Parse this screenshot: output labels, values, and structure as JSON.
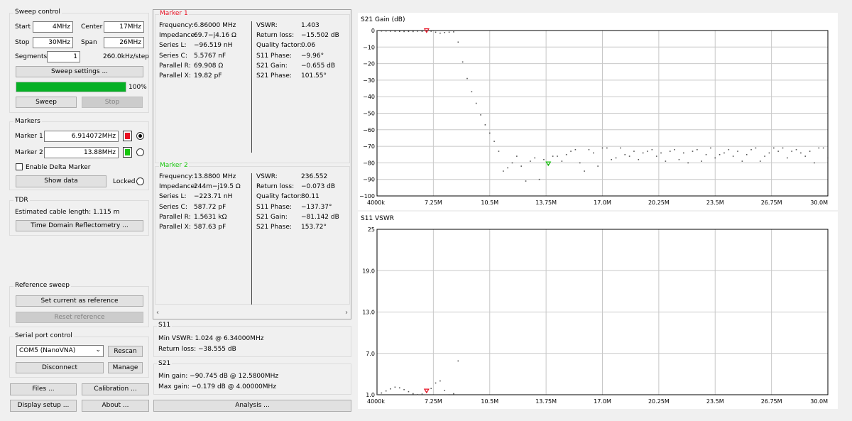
{
  "sweep_control": {
    "title": "Sweep control",
    "start_label": "Start",
    "start_value": "4MHz",
    "center_label": "Center",
    "center_value": "17MHz",
    "stop_label": "Stop",
    "stop_value": "30MHz",
    "span_label": "Span",
    "span_value": "26MHz",
    "segments_label": "Segments",
    "segments_value": "1",
    "step_text": "260.0kHz/step",
    "settings_button": "Sweep settings ...",
    "progress": 100,
    "progress_text": "100%",
    "sweep_button": "Sweep",
    "stop_button": "Stop"
  },
  "markers": {
    "title": "Markers",
    "marker1_label": "Marker 1",
    "marker1_value": "6.914072MHz",
    "marker1_color": "#e81123",
    "marker2_label": "Marker 2",
    "marker2_value": "13.88MHz",
    "marker2_color": "#16c60c",
    "delta_label": "Enable Delta Marker",
    "show_data_button": "Show data",
    "locked_label": "Locked"
  },
  "tdr": {
    "title": "TDR",
    "cable_text": "Estimated cable length:  1.115 m",
    "button": "Time Domain Reflectometry ..."
  },
  "reference": {
    "title": "Reference sweep",
    "set_button": "Set current as reference",
    "reset_button": "Reset reference"
  },
  "serial": {
    "title": "Serial port control",
    "port_value": "COM5 (NanoVNA)",
    "rescan_button": "Rescan",
    "disconnect_button": "Disconnect",
    "manage_button": "Manage"
  },
  "bottom_buttons": {
    "files": "Files ...",
    "calibration": "Calibration ...",
    "display_setup": "Display setup ...",
    "about": "About ...",
    "analysis": "Analysis ..."
  },
  "marker1_data": {
    "title": "Marker 1",
    "left": [
      {
        "k": "Frequency:",
        "v": "6.86000 MHz"
      },
      {
        "k": "Impedance:",
        "v": "69.7−j4.16 Ω"
      },
      {
        "k": "Series L:",
        "v": "−96.519 nH"
      },
      {
        "k": "Series C:",
        "v": "5.5767 nF"
      },
      {
        "k": "Parallel R:",
        "v": "69.908 Ω"
      },
      {
        "k": "Parallel X:",
        "v": "19.82 pF"
      }
    ],
    "right": [
      {
        "k": "VSWR:",
        "v": "1.403"
      },
      {
        "k": "Return loss:",
        "v": "−15.502 dB"
      },
      {
        "k": "Quality factor:",
        "v": "0.06"
      },
      {
        "k": "S11 Phase:",
        "v": "−9.96°"
      },
      {
        "k": "S21 Gain:",
        "v": "−0.655 dB"
      },
      {
        "k": "S21 Phase:",
        "v": "101.55°"
      }
    ]
  },
  "marker2_data": {
    "title": "Marker 2",
    "left": [
      {
        "k": "Frequency:",
        "v": "13.8800 MHz"
      },
      {
        "k": "Impedance:",
        "v": "244m−j19.5 Ω"
      },
      {
        "k": "Series L:",
        "v": "−223.71 nH"
      },
      {
        "k": "Series C:",
        "v": "587.72 pF"
      },
      {
        "k": "Parallel R:",
        "v": "1.5631 kΩ"
      },
      {
        "k": "Parallel X:",
        "v": "587.63 pF"
      }
    ],
    "right": [
      {
        "k": "VSWR:",
        "v": "236.552"
      },
      {
        "k": "Return loss:",
        "v": "−0.073 dB"
      },
      {
        "k": "Quality factor:",
        "v": "80.11"
      },
      {
        "k": "S11 Phase:",
        "v": "−137.37°"
      },
      {
        "k": "S21 Gain:",
        "v": "−81.142 dB"
      },
      {
        "k": "S21 Phase:",
        "v": "153.72°"
      }
    ]
  },
  "s11_summary": {
    "title": "S11",
    "min_vswr": "Min VSWR:  1.024 @ 6.34000MHz",
    "return_loss": "Return loss:  −38.555 dB"
  },
  "s21_summary": {
    "title": "S21",
    "min_gain": "Min gain:  −90.745 dB @ 12.5800MHz",
    "max_gain": "Max gain:  −0.179 dB @ 4.00000MHz"
  },
  "chart_data": [
    {
      "type": "scatter",
      "title": "S21 Gain (dB)",
      "x_unit": "MHz",
      "xlim": [
        4.0,
        30.0
      ],
      "ylim": [
        -100,
        0
      ],
      "x_ticks": [
        4.0,
        7.25,
        10.5,
        13.75,
        17.0,
        20.25,
        23.5,
        26.75,
        30.0
      ],
      "x_tick_labels": [
        "4000k",
        "7.25M",
        "10.5M",
        "13.75M",
        "17.0M",
        "20.25M",
        "23.5M",
        "26.75M",
        "30.0M"
      ],
      "y_ticks": [
        0,
        -10,
        -20,
        -30,
        -40,
        -50,
        -60,
        -70,
        -80,
        -90,
        -100
      ],
      "y_tick_labels": [
        "0",
        "−10",
        "−20",
        "−30",
        "−40",
        "−50",
        "−60",
        "−70",
        "−80",
        "−90",
        "−100"
      ],
      "grid": true,
      "series": [
        {
          "color": "#555555",
          "points": [
            [
              4.0,
              -0.2
            ],
            [
              4.26,
              -0.3
            ],
            [
              4.52,
              -0.3
            ],
            [
              4.78,
              -0.4
            ],
            [
              5.04,
              -0.5
            ],
            [
              5.3,
              -0.5
            ],
            [
              5.56,
              -0.6
            ],
            [
              5.82,
              -0.5
            ],
            [
              6.08,
              -0.6
            ],
            [
              6.34,
              -0.4
            ],
            [
              6.6,
              -0.5
            ],
            [
              6.86,
              -0.6
            ],
            [
              7.12,
              -0.4
            ],
            [
              7.38,
              -1.0
            ],
            [
              7.64,
              -1.6
            ],
            [
              7.9,
              -1.2
            ],
            [
              8.16,
              -1.0
            ],
            [
              8.42,
              -0.8
            ],
            [
              8.68,
              -7
            ],
            [
              8.94,
              -19
            ],
            [
              9.2,
              -29
            ],
            [
              9.46,
              -37
            ],
            [
              9.72,
              -44
            ],
            [
              9.98,
              -51
            ],
            [
              10.24,
              -57
            ],
            [
              10.5,
              -62
            ],
            [
              10.76,
              -67
            ],
            [
              11.02,
              -73
            ],
            [
              11.28,
              -85
            ],
            [
              11.54,
              -83
            ],
            [
              11.8,
              -80
            ],
            [
              12.06,
              -76
            ],
            [
              12.32,
              -82
            ],
            [
              12.58,
              -91
            ],
            [
              12.84,
              -79
            ],
            [
              13.1,
              -77
            ],
            [
              13.36,
              -90
            ],
            [
              13.62,
              -78
            ],
            [
              13.88,
              -81
            ],
            [
              14.14,
              -76
            ],
            [
              14.4,
              -76
            ],
            [
              14.66,
              -79
            ],
            [
              14.92,
              -75
            ],
            [
              15.18,
              -73
            ],
            [
              15.44,
              -72
            ],
            [
              15.7,
              -80
            ],
            [
              15.96,
              -85
            ],
            [
              16.22,
              -72
            ],
            [
              16.48,
              -74
            ],
            [
              16.74,
              -82
            ],
            [
              17.0,
              -71
            ],
            [
              17.26,
              -71
            ],
            [
              17.52,
              -78
            ],
            [
              17.78,
              -77
            ],
            [
              18.04,
              -71
            ],
            [
              18.3,
              -75
            ],
            [
              18.56,
              -76
            ],
            [
              18.82,
              -73
            ],
            [
              19.08,
              -78
            ],
            [
              19.34,
              -74
            ],
            [
              19.6,
              -73
            ],
            [
              19.86,
              -72
            ],
            [
              20.12,
              -76
            ],
            [
              20.38,
              -74
            ],
            [
              20.64,
              -79
            ],
            [
              20.9,
              -73
            ],
            [
              21.16,
              -72
            ],
            [
              21.42,
              -78
            ],
            [
              21.68,
              -74
            ],
            [
              21.94,
              -80
            ],
            [
              22.2,
              -73
            ],
            [
              22.46,
              -72
            ],
            [
              22.72,
              -79
            ],
            [
              22.98,
              -75
            ],
            [
              23.24,
              -71
            ],
            [
              23.5,
              -77
            ],
            [
              23.76,
              -75
            ],
            [
              24.02,
              -74
            ],
            [
              24.28,
              -72
            ],
            [
              24.54,
              -76
            ],
            [
              24.8,
              -73
            ],
            [
              25.06,
              -79
            ],
            [
              25.32,
              -75
            ],
            [
              25.58,
              -72
            ],
            [
              25.84,
              -71
            ],
            [
              26.1,
              -79
            ],
            [
              26.36,
              -76
            ],
            [
              26.62,
              -74
            ],
            [
              26.88,
              -71
            ],
            [
              27.14,
              -73
            ],
            [
              27.4,
              -71
            ],
            [
              27.66,
              -77
            ],
            [
              27.92,
              -73
            ],
            [
              28.18,
              -72
            ],
            [
              28.44,
              -74
            ],
            [
              28.7,
              -76
            ],
            [
              28.96,
              -73
            ],
            [
              29.22,
              -80
            ],
            [
              29.48,
              -71
            ],
            [
              29.74,
              -71
            ],
            [
              30.0,
              -77
            ]
          ]
        }
      ],
      "markers": [
        {
          "x": 6.86,
          "y": -0.655,
          "color": "#e81123"
        },
        {
          "x": 13.88,
          "y": -81.142,
          "color": "#16c60c"
        }
      ]
    },
    {
      "type": "scatter",
      "title": "S11 VSWR",
      "x_unit": "MHz",
      "xlim": [
        4.0,
        30.0
      ],
      "ylim": [
        1.0,
        25.0
      ],
      "x_ticks": [
        4.0,
        7.25,
        10.5,
        13.75,
        17.0,
        20.25,
        23.5,
        26.75,
        30.0
      ],
      "x_tick_labels": [
        "4000k",
        "7.25M",
        "10.5M",
        "13.75M",
        "17.0M",
        "20.25M",
        "23.5M",
        "26.75M",
        "30.0M"
      ],
      "y_ticks": [
        1.0,
        7.0,
        13.0,
        19.0,
        25.0
      ],
      "y_tick_labels": [
        "1.0",
        "7.0",
        "13.0",
        "19.0",
        "25"
      ],
      "grid": true,
      "series": [
        {
          "color": "#555555",
          "points": [
            [
              4.0,
              1.05
            ],
            [
              4.26,
              1.25
            ],
            [
              4.52,
              1.55
            ],
            [
              4.78,
              1.85
            ],
            [
              5.04,
              2.1
            ],
            [
              5.3,
              2.0
            ],
            [
              5.56,
              1.75
            ],
            [
              5.82,
              1.45
            ],
            [
              6.08,
              1.15
            ],
            [
              6.34,
              1.02
            ],
            [
              6.6,
              1.1
            ],
            [
              6.86,
              1.4
            ],
            [
              7.12,
              1.9
            ],
            [
              7.38,
              2.7
            ],
            [
              7.64,
              3.0
            ],
            [
              7.9,
              1.6
            ],
            [
              8.16,
              1.0
            ],
            [
              8.42,
              1.15
            ],
            [
              8.68,
              5.9
            ]
          ]
        }
      ],
      "markers": [
        {
          "x": 6.86,
          "y": 1.403,
          "color": "#e81123"
        }
      ]
    }
  ]
}
